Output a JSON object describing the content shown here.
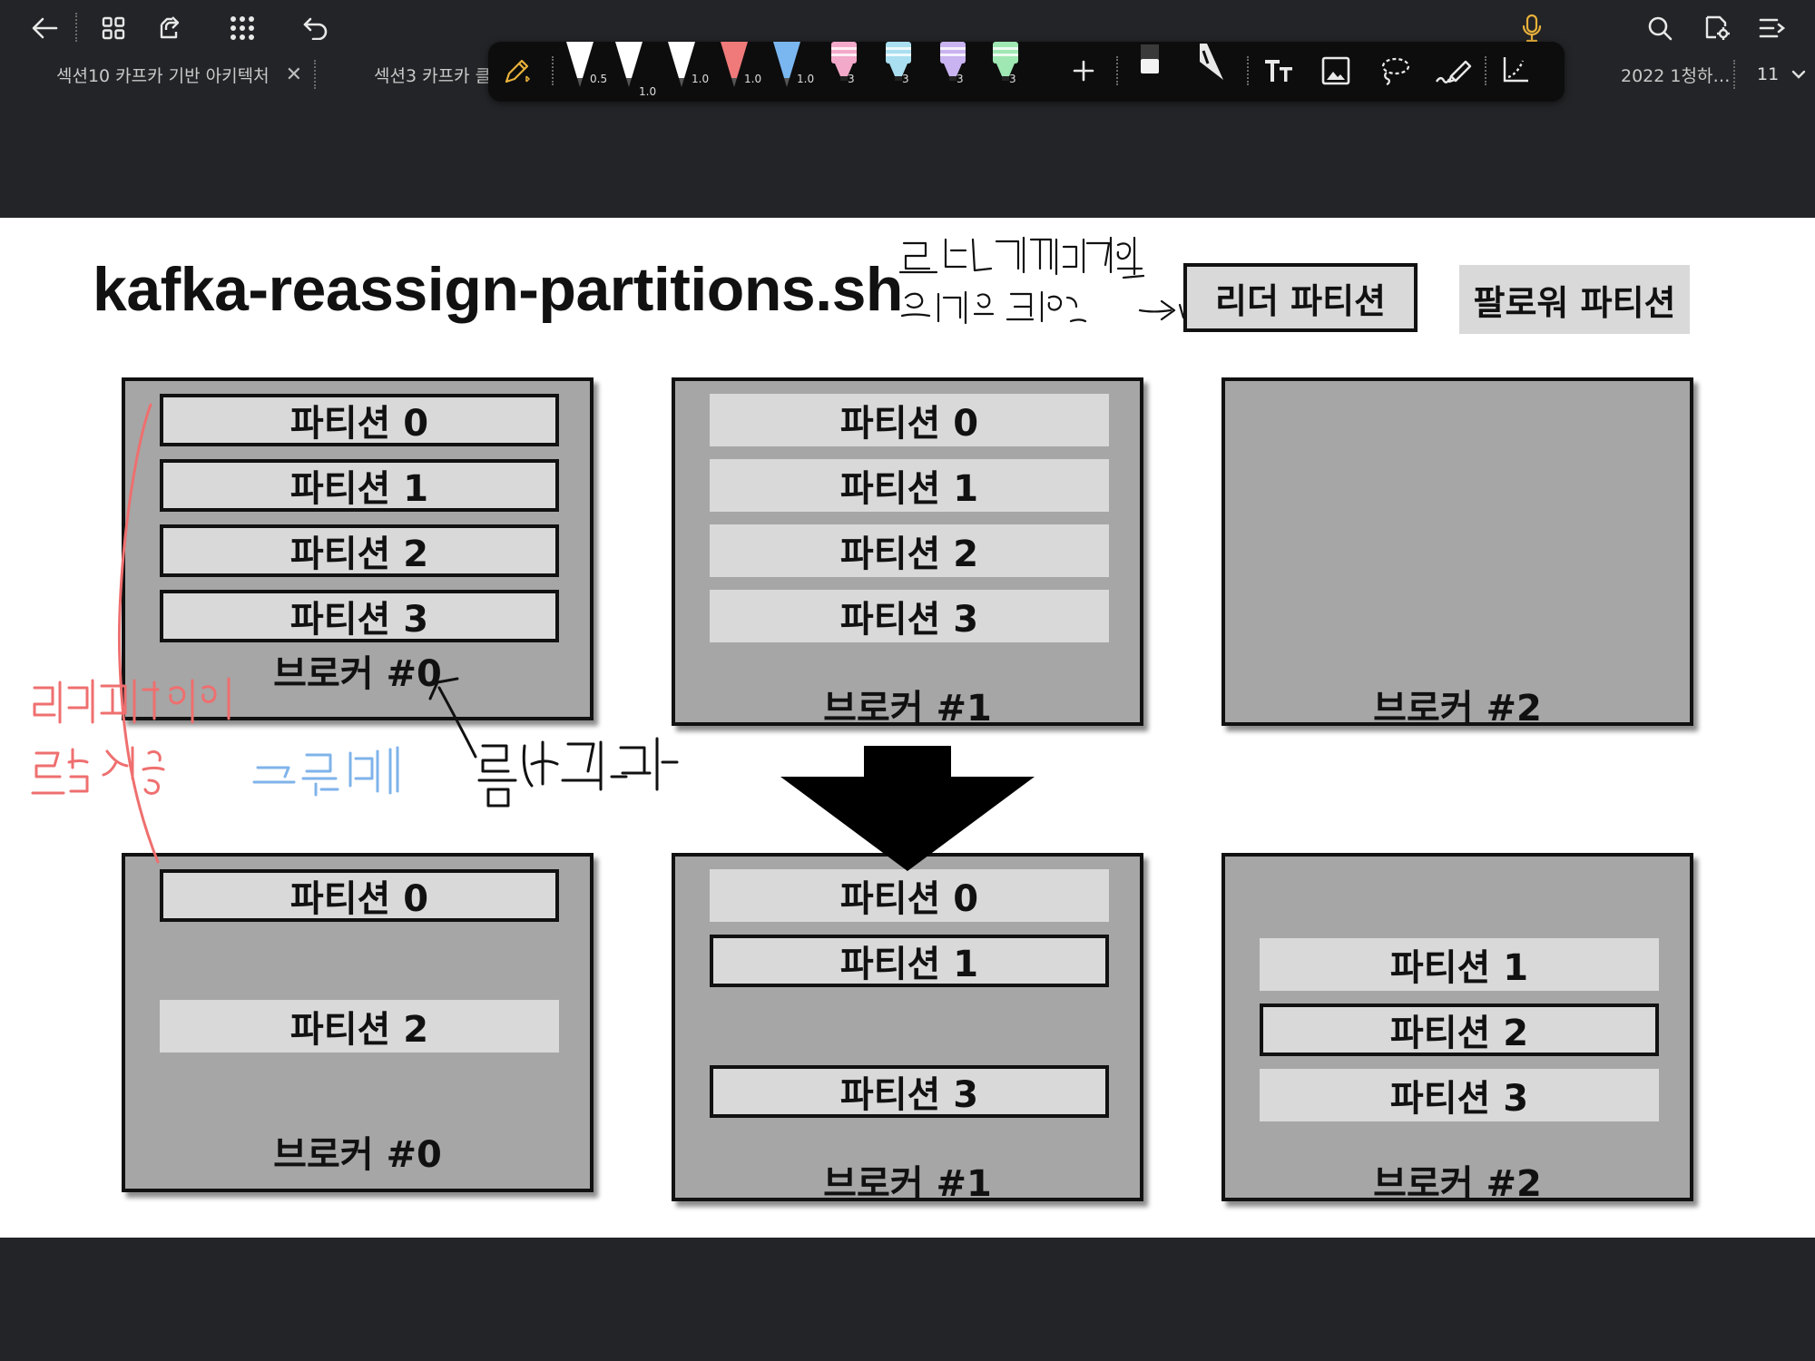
{
  "topbar": {
    "icons": [
      "back-arrow-icon",
      "grid-icon",
      "export-icon",
      "apps-dots-icon",
      "undo-icon",
      "microphone-icon",
      "search-icon",
      "settings-doc-icon",
      "menu-list-icon"
    ],
    "tabs": [
      {
        "label": "섹션10 카프카 기반 아키텍처",
        "closable": true
      },
      {
        "label": "섹션3 카프카 클",
        "closable": false
      },
      {
        "label": "2022 1청하…",
        "closable": false
      }
    ],
    "page_count": "11"
  },
  "pen_toolbar": {
    "pens": [
      {
        "size": "0.5",
        "color": "#ffffff"
      },
      {
        "size": "1.0",
        "color": "#ffffff"
      },
      {
        "size": "1.0",
        "color": "#ffffff"
      },
      {
        "size": "1.0",
        "color": "#f07a7a"
      },
      {
        "size": "1.0",
        "color": "#7ab6f0"
      },
      {
        "size": "3",
        "color": "#f3a9c9"
      },
      {
        "size": "3",
        "color": "#a9dff0"
      },
      {
        "size": "3",
        "color": "#c9b3f0"
      },
      {
        "size": "3",
        "color": "#9fe8b3"
      }
    ],
    "tools": [
      "plus-icon",
      "eraser-icon",
      "ruler-icon",
      "text-icon",
      "image-icon",
      "lasso-icon",
      "highlighter-icon",
      "crop-icon"
    ]
  },
  "slide": {
    "title": "kafka-reassign-partitions.sh",
    "legend": {
      "leader": "리더 파티션",
      "follower": "팔로워 파티션"
    },
    "before": [
      {
        "label": "브로커 #0",
        "partitions": [
          {
            "label": "파티션 0",
            "leader": true
          },
          {
            "label": "파티션 1",
            "leader": true
          },
          {
            "label": "파티션 2",
            "leader": true
          },
          {
            "label": "파티션 3",
            "leader": true
          }
        ]
      },
      {
        "label": "브로커 #1",
        "partitions": [
          {
            "label": "파티션 0",
            "leader": false
          },
          {
            "label": "파티션 1",
            "leader": false
          },
          {
            "label": "파티션 2",
            "leader": false
          },
          {
            "label": "파티션 3",
            "leader": false
          }
        ]
      },
      {
        "label": "브로커 #2",
        "partitions": []
      }
    ],
    "after": [
      {
        "label": "브로커 #0",
        "partitions": [
          {
            "label": "파티션 0",
            "leader": true
          },
          {
            "label": "파티션 2",
            "leader": false
          }
        ]
      },
      {
        "label": "브로커 #1",
        "partitions": [
          {
            "label": "파티션 0",
            "leader": false
          },
          {
            "label": "파티션 1",
            "leader": true
          },
          {
            "label": "파티션 3",
            "leader": true
          }
        ]
      },
      {
        "label": "브로커 #2",
        "partitions": [
          {
            "label": "파티션 1",
            "leader": false
          },
          {
            "label": "파티션 2",
            "leader": true
          },
          {
            "label": "파티션 3",
            "leader": false
          }
        ]
      }
    ],
    "handwriting": {
      "note_top": [
        "브로커는 리더파티션",
        "하고만 통신함"
      ],
      "note_red": [
        "리더파티션이",
        "몰린 상황"
      ],
      "note_blue": "큰부하",
      "note_black": "통신과다",
      "ink_colors": {
        "black": "#111111",
        "red": "#ef6f6f",
        "blue": "#7fb3ea"
      }
    }
  }
}
